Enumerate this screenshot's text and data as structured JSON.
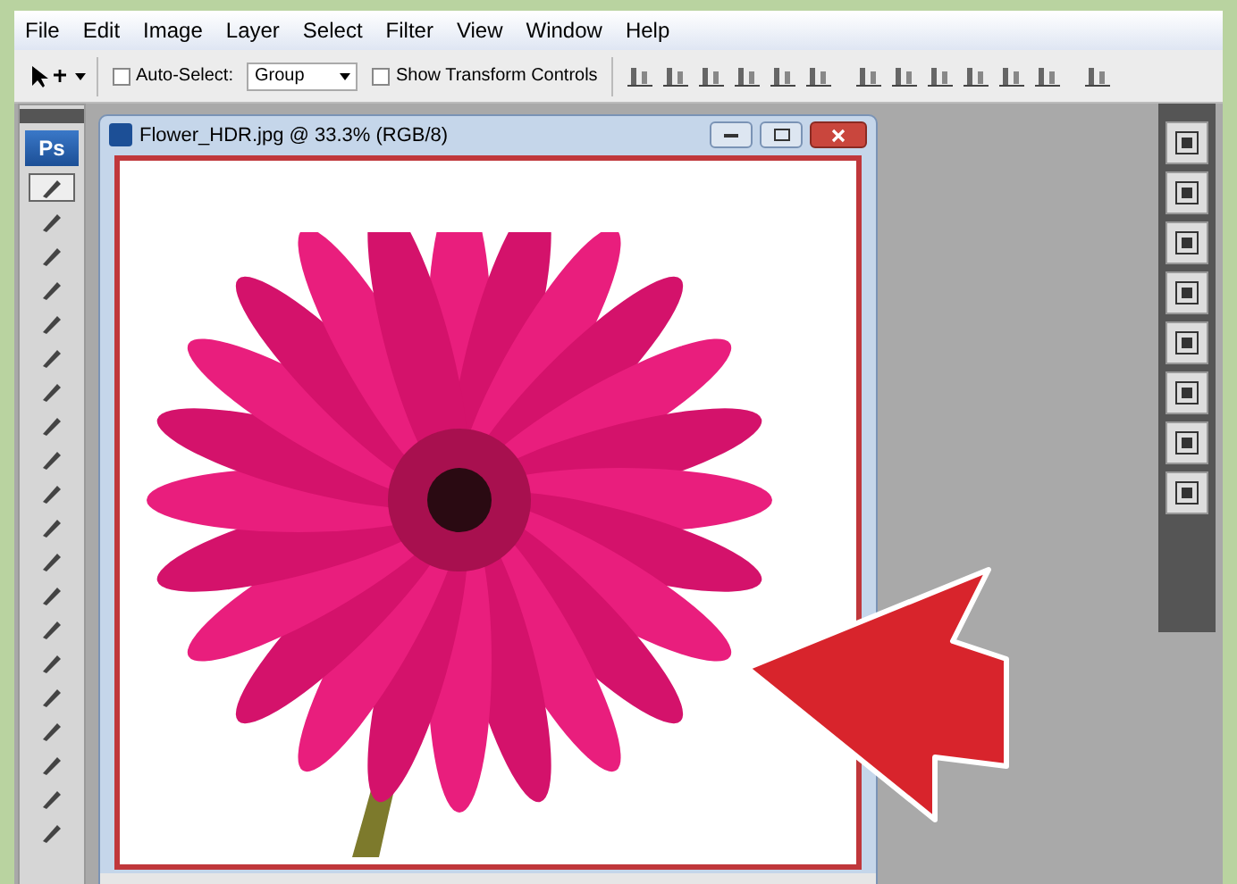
{
  "menu": [
    "File",
    "Edit",
    "Image",
    "Layer",
    "Select",
    "Filter",
    "View",
    "Window",
    "Help"
  ],
  "options_bar": {
    "auto_select": {
      "label": "Auto-Select:",
      "checked": false
    },
    "group_select": {
      "value": "Group"
    },
    "transform_controls": {
      "label": "Show Transform Controls",
      "checked": false
    }
  },
  "toolbox": {
    "logo": "Ps"
  },
  "document": {
    "title": "Flower_HDR.jpg @ 33.3% (RGB/8)"
  }
}
